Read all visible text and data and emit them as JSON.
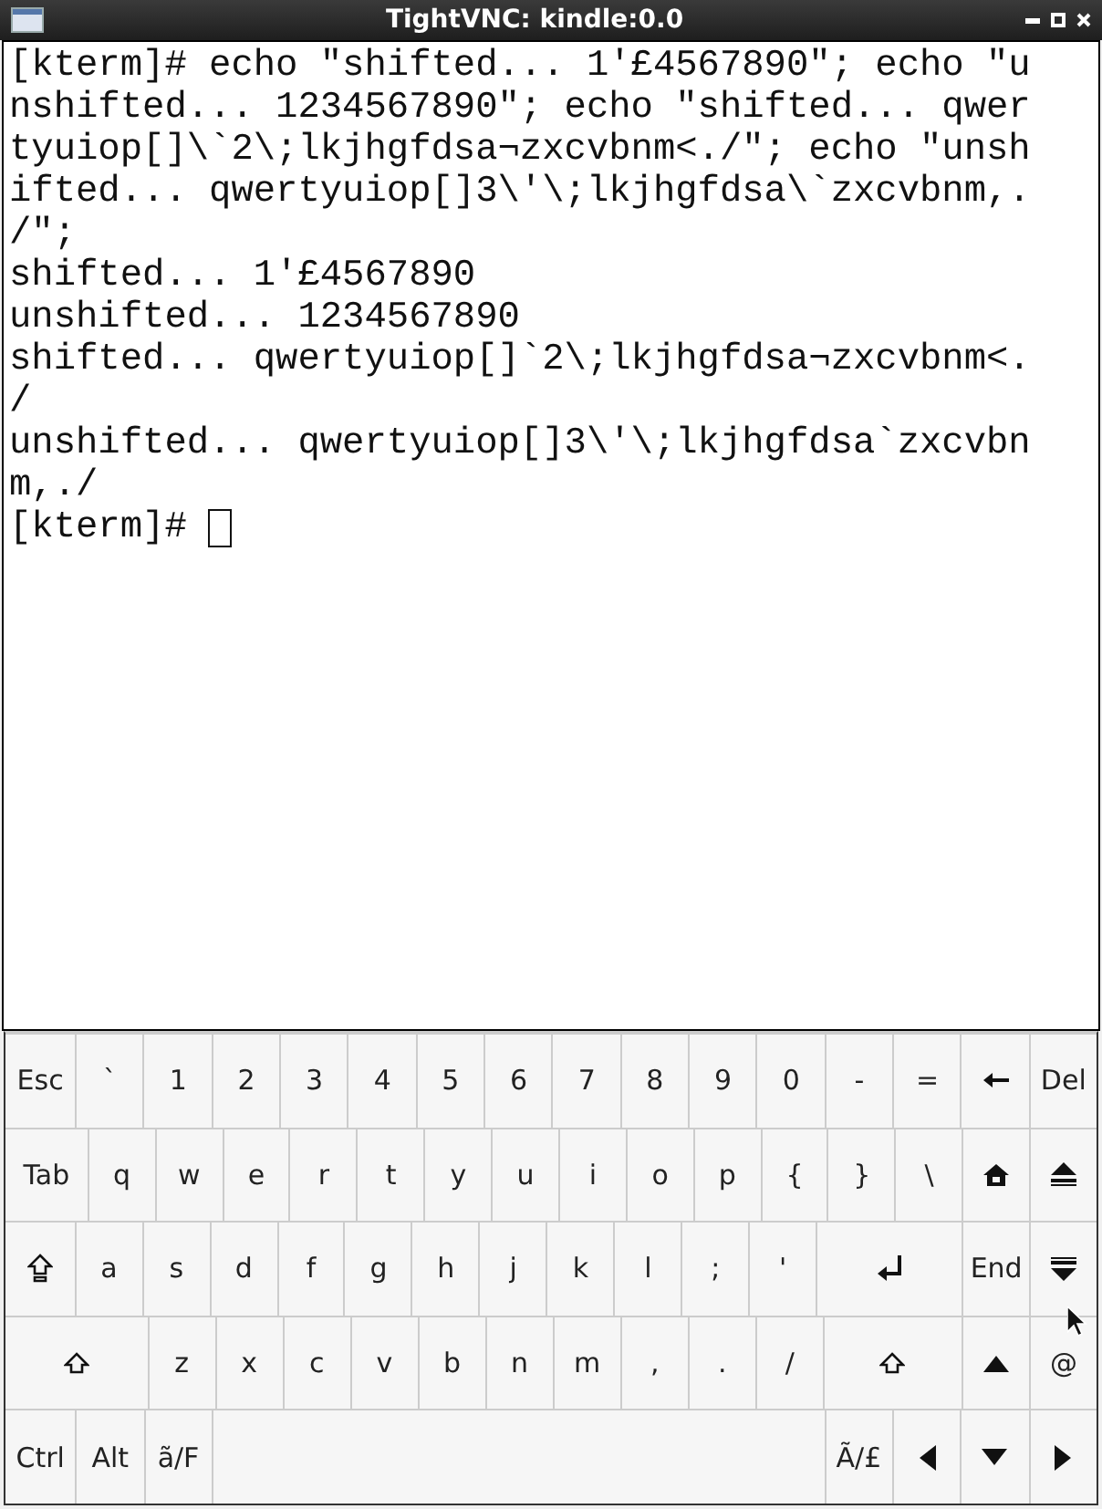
{
  "window": {
    "title": "TightVNC: kindle:0.0"
  },
  "terminal": {
    "lines": [
      "[kterm]# echo \"shifted... 1'£4567890\"; echo \"u",
      "nshifted... 1234567890\"; echo \"shifted... qwer",
      "tyuiop[]\\`2\\;lkjhgfdsa¬zxcvbnm<./\"; echo \"unsh",
      "ifted... qwertyuiop[]3\\'\\;lkjhgfdsa\\`zxcvbnm,.",
      "/\";",
      "shifted... 1'£4567890",
      "unshifted... 1234567890",
      "shifted... qwertyuiop[]`2\\;lkjhgfdsa¬zxcvbnm<.",
      "/",
      "unshifted... qwertyuiop[]3\\'\\;lkjhgfdsa`zxcvbn",
      "m,./"
    ],
    "prompt": "[kterm]#"
  },
  "keyboard": {
    "rows": [
      {
        "keys": [
          {
            "kind": "char",
            "label": "Esc"
          },
          {
            "kind": "char",
            "label": "`"
          },
          {
            "kind": "char",
            "label": "1"
          },
          {
            "kind": "char",
            "label": "2"
          },
          {
            "kind": "char",
            "label": "3"
          },
          {
            "kind": "char",
            "label": "4"
          },
          {
            "kind": "char",
            "label": "5"
          },
          {
            "kind": "char",
            "label": "6"
          },
          {
            "kind": "char",
            "label": "7"
          },
          {
            "kind": "char",
            "label": "8"
          },
          {
            "kind": "char",
            "label": "9"
          },
          {
            "kind": "char",
            "label": "0"
          },
          {
            "kind": "char",
            "label": "-"
          },
          {
            "kind": "char",
            "label": "="
          },
          {
            "kind": "backspace"
          },
          {
            "kind": "char",
            "label": "Del"
          }
        ]
      },
      {
        "keys": [
          {
            "kind": "char",
            "label": "Tab"
          },
          {
            "kind": "char",
            "label": "q"
          },
          {
            "kind": "char",
            "label": "w"
          },
          {
            "kind": "char",
            "label": "e"
          },
          {
            "kind": "char",
            "label": "r"
          },
          {
            "kind": "char",
            "label": "t"
          },
          {
            "kind": "char",
            "label": "y"
          },
          {
            "kind": "char",
            "label": "u"
          },
          {
            "kind": "char",
            "label": "i"
          },
          {
            "kind": "char",
            "label": "o"
          },
          {
            "kind": "char",
            "label": "p"
          },
          {
            "kind": "char",
            "label": "{"
          },
          {
            "kind": "char",
            "label": "}"
          },
          {
            "kind": "char",
            "label": "\\"
          },
          {
            "kind": "home"
          },
          {
            "kind": "pageup"
          }
        ]
      },
      {
        "keys": [
          {
            "kind": "capslock"
          },
          {
            "kind": "char",
            "label": "a"
          },
          {
            "kind": "char",
            "label": "s"
          },
          {
            "kind": "char",
            "label": "d"
          },
          {
            "kind": "char",
            "label": "f"
          },
          {
            "kind": "char",
            "label": "g"
          },
          {
            "kind": "char",
            "label": "h"
          },
          {
            "kind": "char",
            "label": "j"
          },
          {
            "kind": "char",
            "label": "k"
          },
          {
            "kind": "char",
            "label": "l"
          },
          {
            "kind": "char",
            "label": ";"
          },
          {
            "kind": "char",
            "label": "'"
          },
          {
            "kind": "enter"
          },
          {
            "kind": "char",
            "label": "End"
          },
          {
            "kind": "pagedown"
          }
        ]
      },
      {
        "keys": [
          {
            "kind": "shift"
          },
          {
            "kind": "char",
            "label": "z"
          },
          {
            "kind": "char",
            "label": "x"
          },
          {
            "kind": "char",
            "label": "c"
          },
          {
            "kind": "char",
            "label": "v"
          },
          {
            "kind": "char",
            "label": "b"
          },
          {
            "kind": "char",
            "label": "n"
          },
          {
            "kind": "char",
            "label": "m"
          },
          {
            "kind": "char",
            "label": ","
          },
          {
            "kind": "char",
            "label": "."
          },
          {
            "kind": "char",
            "label": "/"
          },
          {
            "kind": "shift"
          },
          {
            "kind": "up"
          },
          {
            "kind": "char",
            "label": "@"
          }
        ]
      },
      {
        "keys": [
          {
            "kind": "char",
            "label": "Ctrl"
          },
          {
            "kind": "char",
            "label": "Alt"
          },
          {
            "kind": "char",
            "label": "ã/F"
          },
          {
            "kind": "space"
          },
          {
            "kind": "char",
            "label": "Ã/£"
          },
          {
            "kind": "left"
          },
          {
            "kind": "down"
          },
          {
            "kind": "right"
          }
        ]
      }
    ]
  }
}
